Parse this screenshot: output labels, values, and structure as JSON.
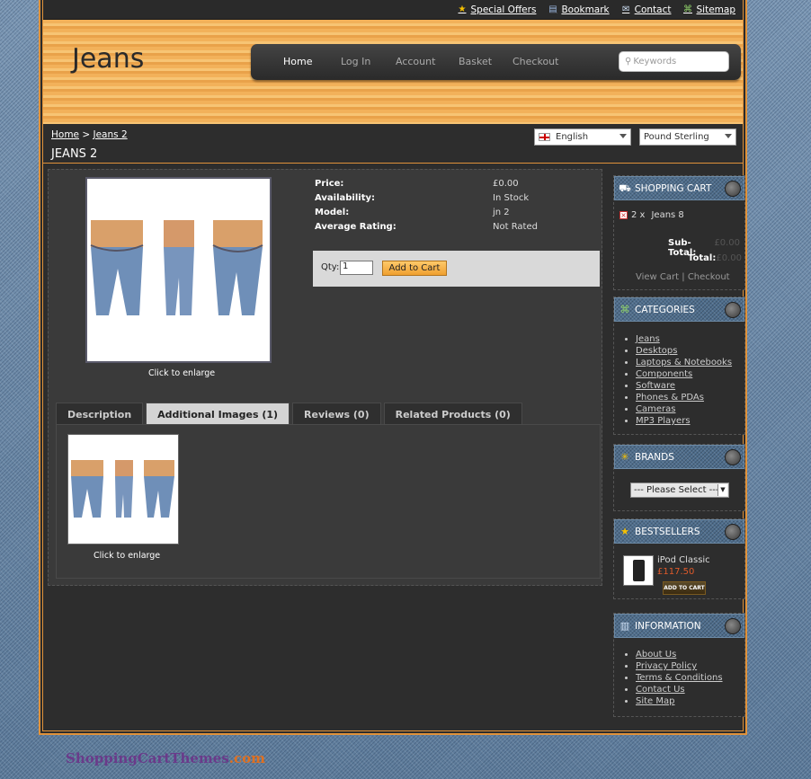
{
  "toplinks": [
    {
      "label": "Special Offers",
      "icon": "star-icon"
    },
    {
      "label": "Bookmark",
      "icon": "bookmark-icon"
    },
    {
      "label": "Contact",
      "icon": "mail-icon"
    },
    {
      "label": "Sitemap",
      "icon": "sitemap-icon"
    }
  ],
  "header": {
    "logo": "Jeans",
    "menu": [
      "Home",
      "Log In",
      "Account",
      "Basket",
      "Checkout"
    ],
    "search_placeholder": "Keywords"
  },
  "breadcrumb": [
    "Home",
    "Jeans 2"
  ],
  "language": "English",
  "currency": "Pound Sterling",
  "product": {
    "title": "JEANS 2",
    "click_to_enlarge": "Click to enlarge",
    "details": [
      {
        "label": "Price:",
        "value": "£0.00"
      },
      {
        "label": "Availability:",
        "value": "In Stock"
      },
      {
        "label": "Model:",
        "value": "jn 2"
      },
      {
        "label": "Average Rating:",
        "value": "Not Rated"
      }
    ],
    "qty_label": "Qty:",
    "qty_value": "1",
    "add_to_cart": "Add to Cart"
  },
  "tabs": [
    "Description",
    "Additional Images (1)",
    "Reviews (0)",
    "Related Products (0)"
  ],
  "active_tab": "Additional Images (1)",
  "sidebar": {
    "cart": {
      "title": "SHOPPING CART",
      "qty": "2 x",
      "item": "Jeans 8",
      "subtotal_label": "Sub-Total:",
      "subtotal": "£0.00",
      "total_label": "Total:",
      "total": "£0.00",
      "view_cart": "View Cart",
      "separator": "|",
      "checkout": "Checkout"
    },
    "categories": {
      "title": "CATEGORIES",
      "items": [
        "Jeans",
        "Desktops",
        "Laptops & Notebooks",
        "Components",
        "Software",
        "Phones & PDAs",
        "Cameras",
        "MP3 Players"
      ]
    },
    "brands": {
      "title": "BRANDS",
      "select": "--- Please Select ---"
    },
    "bestsellers": {
      "title": "BESTSELLERS",
      "item": "iPod Classic",
      "price": "£117.50",
      "button": "ADD TO CART"
    },
    "information": {
      "title": "INFORMATION",
      "items": [
        "About Us",
        "Privacy Policy",
        "Terms & Conditions",
        "Contact Us",
        "Site Map"
      ]
    }
  },
  "footer_logo": {
    "main": "ShoppingCartThemes",
    "suffix": ".com"
  },
  "colors": {
    "accent": "#e0923a",
    "header": "#f2b15a",
    "denim": "#6e8aa8",
    "price": "#e05a2a"
  }
}
